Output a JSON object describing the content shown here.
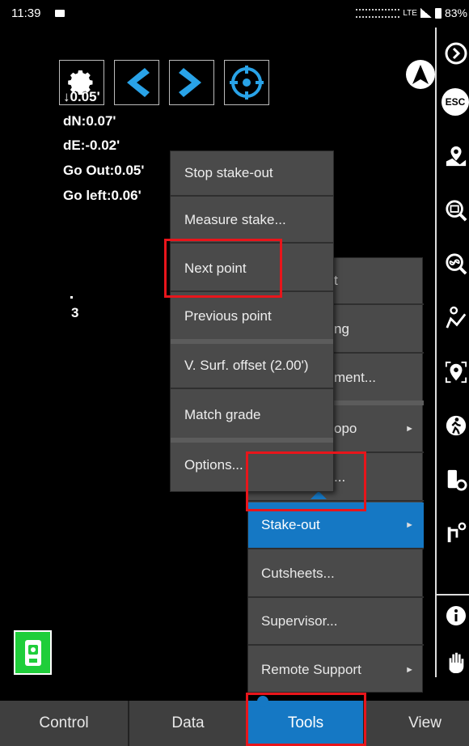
{
  "status_bar": {
    "time": "11:39",
    "network": "LTE",
    "battery": "83%"
  },
  "info": {
    "lines": [
      "↓0.05'",
      "dN:0.07'",
      "dE:-0.02'",
      "Go Out:0.05'",
      "Go left:0.06'"
    ],
    "point_label": "3"
  },
  "toolbar_icons": [
    "gear-icon",
    "chevron-left-icon",
    "chevron-right-icon",
    "target-icon"
  ],
  "sidebar": {
    "esc_label": "ESC"
  },
  "main_menu": {
    "items": [
      {
        "label": "t"
      },
      {
        "label": "ng"
      },
      {
        "label": "ment..."
      },
      {
        "label": "opo"
      },
      {
        "label": "..."
      },
      {
        "label": "Stake-out"
      },
      {
        "label": "Cutsheets..."
      },
      {
        "label": "Supervisor..."
      },
      {
        "label": "Remote Support"
      }
    ]
  },
  "submenu": {
    "items": [
      {
        "label": "Stop stake-out"
      },
      {
        "label": "Measure stake..."
      },
      {
        "label": "Next point"
      },
      {
        "label": "Previous point"
      },
      {
        "label": "V. Surf. offset (2.00')"
      },
      {
        "label": "Match grade"
      },
      {
        "label": "Options..."
      }
    ]
  },
  "bottom_tabs": [
    {
      "label": "Control"
    },
    {
      "label": "Data"
    },
    {
      "label": "Tools"
    },
    {
      "label": "View"
    }
  ],
  "colors": {
    "accent": "#1578c4",
    "highlight": "#e8151b",
    "instrument": "#1fce3a",
    "menu_bg": "#4a4a4a"
  }
}
